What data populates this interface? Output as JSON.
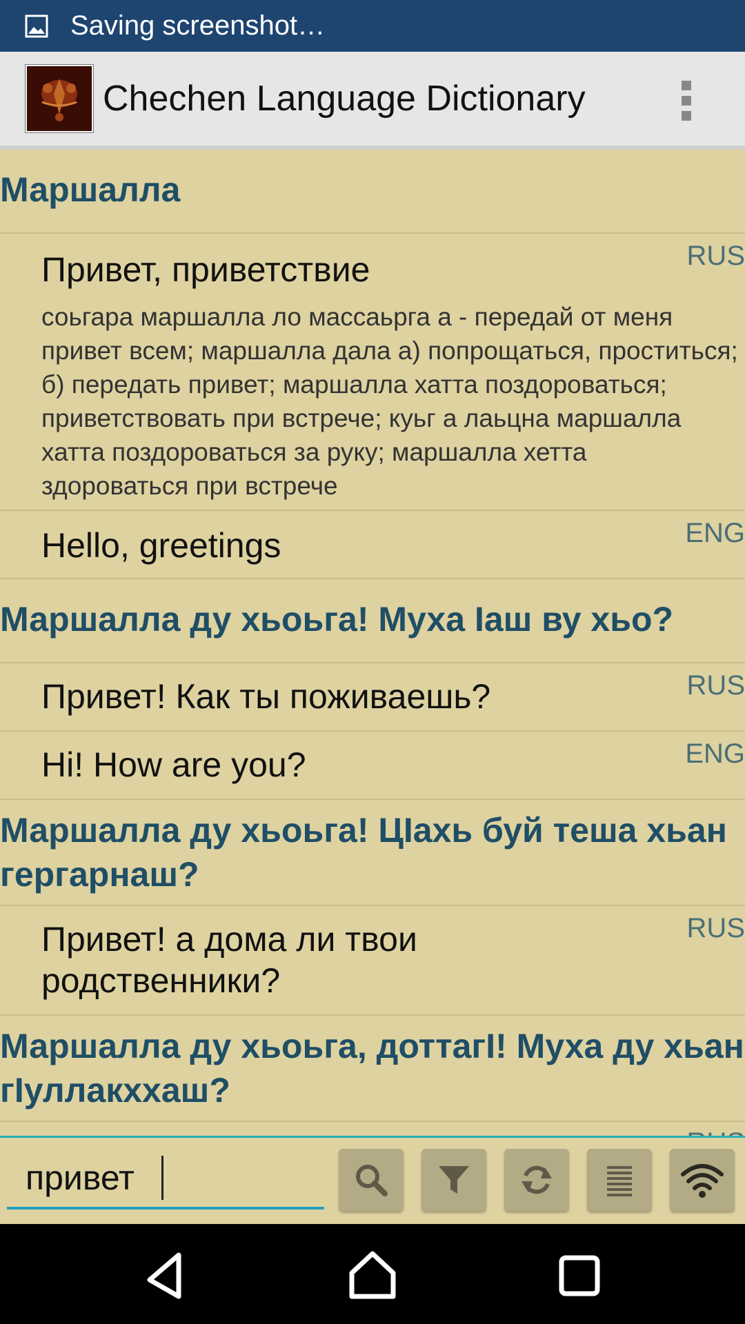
{
  "status": {
    "text": "Saving screenshot…"
  },
  "app": {
    "title": "Chechen Language Dictionary"
  },
  "entries": [
    {
      "headword": "Маршалла",
      "translations": [
        {
          "text": "Привет, приветствие",
          "lang": "RUS",
          "example": "соьгара маршалла ло массаьрга а - передай от меня привет всем; маршалла дала а) попрощаться, проститься; б) передать привет; маршалла хатта поздороваться; приветствовать при встрече; куьг а лаьцна маршалла хатта поздороваться за руку; маршалла хетта здороваться при встрече"
        },
        {
          "text": "Hello, greetings",
          "lang": "ENG"
        }
      ]
    },
    {
      "headword": "Маршалла ду хьоьга! Муха Iаш ву хьо?",
      "translations": [
        {
          "text": "Привет! Как ты поживаешь?",
          "lang": "RUS"
        },
        {
          "text": "Hi! How are you?",
          "lang": "ENG"
        }
      ]
    },
    {
      "headword": "Маршалла ду хьоьга! ЦIахь буй теша хьан гергарнаш?",
      "translations": [
        {
          "text": "Привет! а дома ли твои родственники?",
          "lang": "RUS"
        }
      ]
    },
    {
      "headword": "Маршалла ду хьоьга, доттагI! Муха ду хьан гIуллакххаш?",
      "translations": [
        {
          "text": "",
          "lang": "RUS"
        }
      ]
    }
  ],
  "search": {
    "value": "привет"
  },
  "toolbar": {
    "buttons": [
      "search-icon",
      "filter-icon",
      "refresh-icon",
      "list-icon",
      "wifi-icon"
    ]
  },
  "colors": {
    "status_bar": "#1e4470",
    "app_bar": "#e6e6e6",
    "content_bg": "#ded2a0",
    "headword": "#1f4e66",
    "lang_tag": "#4a6e77",
    "accent": "#26b0b5",
    "button": "#b3aa86"
  }
}
